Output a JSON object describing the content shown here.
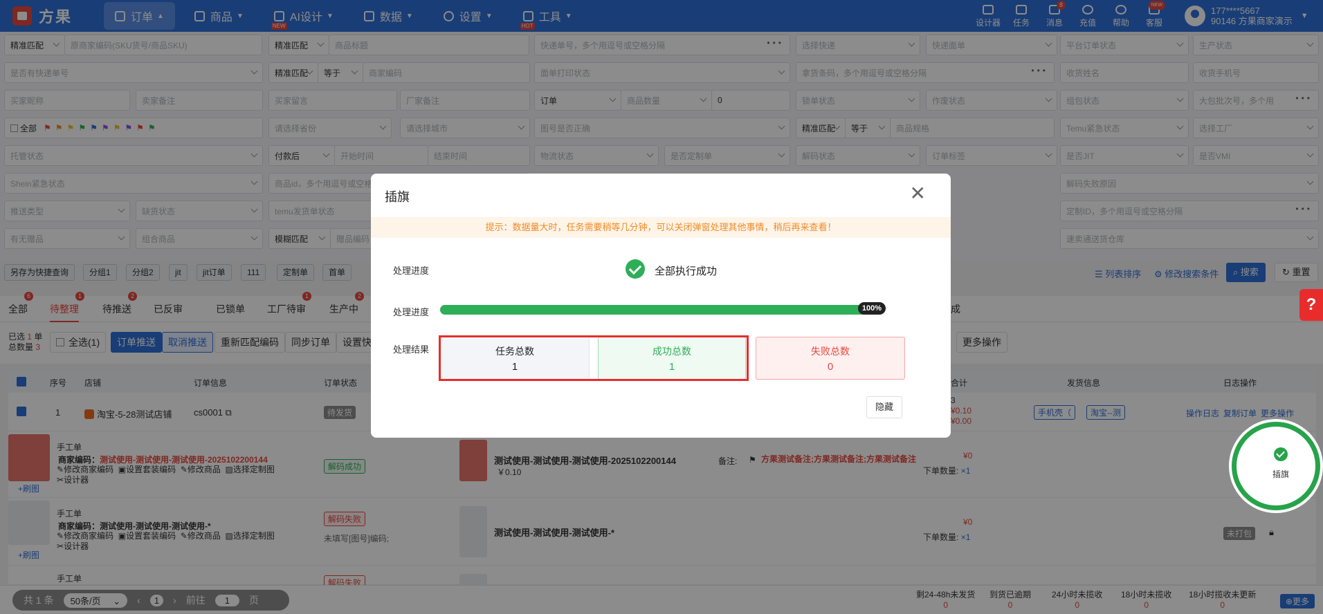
{
  "app": {
    "logo": "方果"
  },
  "nav": {
    "menu": [
      {
        "label": "订单",
        "active": true
      },
      {
        "label": "商品"
      },
      {
        "label": "AI设计",
        "tag": "NEW"
      },
      {
        "label": "数据"
      },
      {
        "label": "设置"
      },
      {
        "label": "工具",
        "tag": "HOT"
      }
    ],
    "tools": [
      {
        "label": "设计器"
      },
      {
        "label": "任务"
      },
      {
        "label": "消息",
        "badge": "8"
      },
      {
        "label": "充值"
      },
      {
        "label": "帮助"
      },
      {
        "label": "客服",
        "badge": "NEW"
      }
    ],
    "user": {
      "phone": "177****5667",
      "name": "90146 方果商家演示"
    }
  },
  "filters": {
    "r1": [
      "精准匹配",
      "原商家编码(SKU货号/商品SKU)",
      "精准匹配",
      "商品标题",
      "快递单号，多个用逗号或空格分隔",
      "选择快递",
      "快递面单",
      "平台订单状态",
      "生产状态"
    ],
    "r2": [
      "是否有快递单号",
      "精准匹配",
      "等于",
      "商家编码",
      "面单打印状态",
      "拿货条码，多个用逗号或空格分隔",
      "收货姓名",
      "收货手机号"
    ],
    "r3": [
      "买家昵称",
      "卖家备注",
      "买家留言",
      "厂家备注",
      "订单",
      "商品数量",
      "0",
      "锁单状态",
      "作废状态",
      "组包状态",
      "大包批次号，多个用"
    ],
    "r4": [
      "全部",
      "请选择省份",
      "请选择城市",
      "图号是否正确",
      "精准匹配",
      "等于",
      "商品规格",
      "Temu紧急状态",
      "选择工厂"
    ],
    "r5": [
      "托管状态",
      "付款后",
      "开始时间",
      "结束时间",
      "物流状态",
      "是否定制单",
      "解码状态",
      "订单标签",
      "是否JIT",
      "是否VMI"
    ],
    "r6": [
      "Shein紧急状态",
      "商品id，多个用逗号或空格",
      "解码失败原因"
    ],
    "r7": [
      "推送类型",
      "缺货状态",
      "temu发货单状态",
      "定制ID，多个用逗号或空格分隔"
    ],
    "r8": [
      "有无赠品",
      "组合商品",
      "模糊匹配",
      "赠品编码",
      "速卖通送货仓库"
    ],
    "quick": [
      "另存为快捷查询",
      "分组1",
      "分组2",
      "jit",
      "jit订单",
      "111",
      "定制单",
      "首单"
    ],
    "right_links": [
      "列表排序",
      "修改搜索条件"
    ],
    "search": "搜索",
    "reset": "重置"
  },
  "tabs": [
    {
      "label": "全部",
      "badge": "6"
    },
    {
      "label": "待整理",
      "badge": "1",
      "active": true
    },
    {
      "label": "待推送",
      "badge": "2"
    },
    {
      "label": "已反审"
    },
    {
      "label": "已锁单"
    },
    {
      "label": "工厂待审",
      "badge": "1"
    },
    {
      "label": "生产中",
      "badge": "2"
    }
  ],
  "tab_tail": "成",
  "actions": {
    "selected_prefix": "已选",
    "selected_count": "1",
    "selected_unit": "单",
    "total_prefix": "总数量",
    "total_count": "3",
    "buttons": [
      "全选(1)",
      "订单推送",
      "取消推送",
      "重新匹配编码",
      "同步订单",
      "设置快"
    ],
    "more": "更多操作"
  },
  "table": {
    "headers": [
      "序号",
      "店铺",
      "订单信息",
      "订单状态",
      "合计",
      "发货信息",
      "日志操作"
    ],
    "order": {
      "seq": "1",
      "shop": "淘宝-5-28测试店铺",
      "order_no": "cs0001",
      "status": "待发货",
      "sum_label": "3",
      "sum_a": "¥0.10",
      "sum_b": "¥0.00",
      "ship_a": "手机壳（",
      "ship_b": "淘宝--测",
      "ops": [
        "操作日志",
        "复制订单",
        "更多操作"
      ]
    },
    "items": [
      {
        "type": "手工单",
        "code_label": "商家编码：",
        "code": "测试使用-测试使用-测试使用-2025102200144",
        "links": [
          "修改商家编码",
          "设置套装编码",
          "修改商品",
          "选择定制图"
        ],
        "designer": "设计器",
        "refresh": "+刷图",
        "decode": "解码成功",
        "title": "测试使用-测试使用-测试使用-2025102200144",
        "price": "￥0.10",
        "remark_label": "备注:",
        "remark": "方果测试备注;方果测试备注;方果测试备注",
        "amt": "¥0",
        "qty_label": "下单数量:",
        "qty": "×1"
      },
      {
        "type": "手工单",
        "code_label": "商家编码：",
        "code": "测试使用-测试使用-测试使用-*",
        "links": [
          "修改商家编码",
          "设置套装编码",
          "修改商品",
          "选择定制图"
        ],
        "designer": "设计器",
        "refresh": "+刷图",
        "decode": "解码失败",
        "decode_note": "未填写[图号]编码;",
        "title": "测试使用-测试使用-测试使用-*",
        "amt": "¥0",
        "qty_label": "下单数量:",
        "qty": "×1",
        "pack": "未打包"
      },
      {
        "type": "手工单",
        "decode": "解码失败"
      }
    ]
  },
  "bottom": {
    "total": "共 1 条",
    "size": "50条/页",
    "page": "1",
    "goto": "前往",
    "goto_page": "1",
    "unit": "页",
    "stats": [
      {
        "label": "剩24-48h未发货",
        "value": "0"
      },
      {
        "label": "到货已逾期",
        "value": "0"
      },
      {
        "label": "24小时未揽收",
        "value": "0"
      },
      {
        "label": "18小时未揽收",
        "value": "0"
      },
      {
        "label": "18小时揽收未更新",
        "value": "0"
      }
    ],
    "more": "更多"
  },
  "modal": {
    "title": "插旗",
    "tip": "提示：数据量大时，任务需要稍等几分钟，可以关闭弹窗处理其他事情，稍后再来查看！",
    "progress_label_1": "处理进度",
    "status_text": "全部执行成功",
    "progress_label_2": "处理进度",
    "progress": 100,
    "progress_text": "100%",
    "result_label": "处理结果",
    "cards": [
      {
        "label": "任务总数",
        "value": "1"
      },
      {
        "label": "成功总数",
        "value": "1"
      },
      {
        "label": "失败总数",
        "value": "0"
      }
    ],
    "hide": "隐藏"
  },
  "float": {
    "help": "?",
    "ring_label": "插旗"
  },
  "colors": {
    "primary": "#2f6fd8",
    "success": "#2fae58",
    "danger": "#e8473c"
  }
}
